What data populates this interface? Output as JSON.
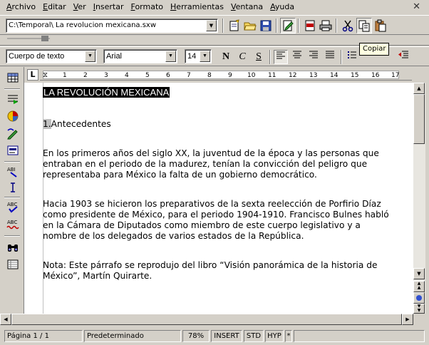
{
  "menu": {
    "items": [
      "Archivo",
      "Editar",
      "Ver",
      "Insertar",
      "Formato",
      "Herramientas",
      "Ventana",
      "Ayuda"
    ],
    "close_symbol": "✕"
  },
  "toolbar": {
    "file_path": "C:\\Temporal\\ La revolucion mexicana.sxw",
    "tooltip": "Copiar"
  },
  "format": {
    "paragraph_style": "Cuerpo de texto",
    "font_name": "Arial",
    "font_size": "14",
    "bold_label": "N",
    "italic_label": "C",
    "underline_label": "S"
  },
  "ruler": {
    "corner_symbol": "L",
    "numbers": [
      "1",
      "2",
      "3",
      "4",
      "5",
      "6",
      "7",
      "8",
      "9",
      "10",
      "11",
      "12",
      "13",
      "14",
      "15",
      "16",
      "17"
    ]
  },
  "document": {
    "title": "LA REVOLUCIÓN MEXICANA",
    "heading_number": "1.",
    "heading_text": "Antecedentes",
    "paragraphs": [
      "En los primeros años del siglo XX, la juventud de la época y las personas que\nentraban en el periodo de la madurez, tenían la convicción del peligro que\nrepresentaba para México la falta de un gobierno democrático.",
      "Hacia 1903 se hicieron los preparativos de la sexta reelección de Porfirio Díaz\ncomo presidente de México, para el periodo 1904-1910. Francisco Bulnes habló\nen la Cámara de Diputados como miembro de este cuerpo legislativo y a\nnombre de los delegados de varios estados de la República.",
      "Nota: Este párrafo se reprodujo del libro “Visión panorámica de la historia de\nMéxico”, Martín Quirarte."
    ]
  },
  "status": {
    "page": "Página  1 / 1",
    "page_style": "Predeterminado",
    "zoom": "78%",
    "insert_mode": "INSERT",
    "selection_mode": "STD",
    "hyperlink_mode": "HYP",
    "modified": "*"
  },
  "colors": {
    "chrome": "#d4d0c8",
    "document_bg": "#ffffff",
    "tooltip_bg": "#ffffe1"
  }
}
